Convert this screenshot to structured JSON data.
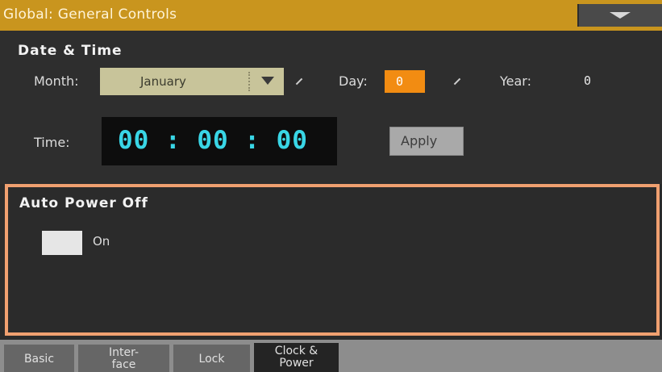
{
  "window": {
    "title": "Global: General Controls",
    "menu_icon": "triangle-down-icon"
  },
  "date_time": {
    "section_title": "Date & Time",
    "month_label": "Month:",
    "month_value": "January",
    "day_label": "Day:",
    "day_value": "0",
    "year_label": "Year:",
    "year_value": "0",
    "time_label": "Time:",
    "time_value": "00 : 00 : 00",
    "apply_label": "Apply"
  },
  "auto_power_off": {
    "section_title": "Auto Power Off",
    "on_label": "On",
    "on_checked": false
  },
  "tabs": [
    {
      "line1": "Basic",
      "line2": ""
    },
    {
      "line1": "Inter-",
      "line2": "face"
    },
    {
      "line1": "Lock",
      "line2": ""
    },
    {
      "line1": "Clock &",
      "line2": "Power"
    }
  ],
  "active_tab": 3,
  "colors": {
    "title_bar": "#c9951e",
    "day_highlight": "#f28c12",
    "time_digits": "#39d6e6",
    "selection_border": "#f0a070",
    "month_field": "#c8c49a"
  }
}
